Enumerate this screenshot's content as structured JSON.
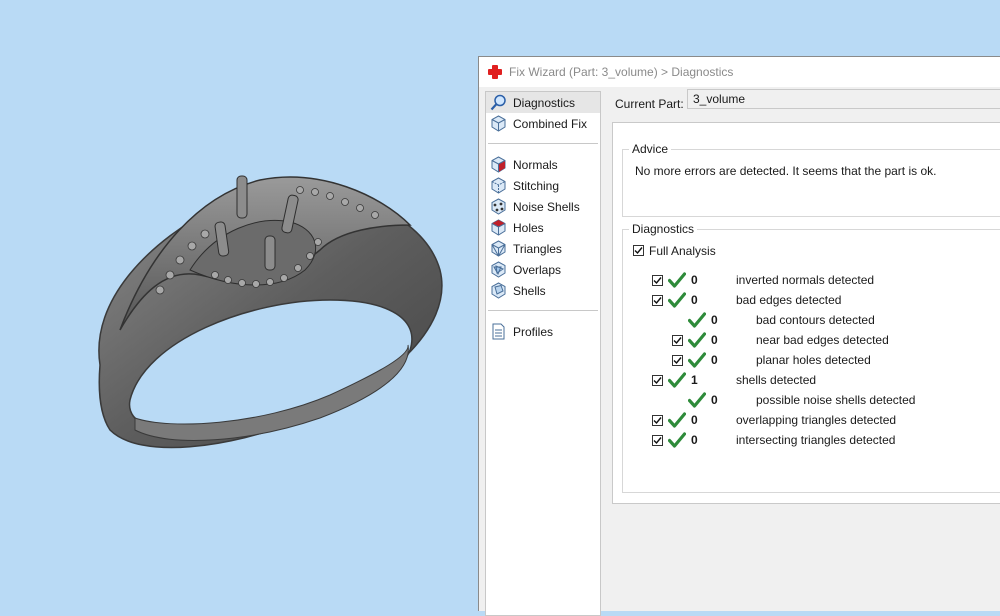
{
  "window": {
    "title": "Fix Wizard (Part: 3_volume) > Diagnostics"
  },
  "nav": {
    "items": [
      {
        "label": "Diagnostics",
        "icon": "magnifier-icon"
      },
      {
        "label": "Combined Fix",
        "icon": "cube-icon"
      },
      {
        "label": "Normals",
        "icon": "normals-cube-icon"
      },
      {
        "label": "Stitching",
        "icon": "stitching-cube-icon"
      },
      {
        "label": "Noise Shells",
        "icon": "noise-shells-icon"
      },
      {
        "label": "Holes",
        "icon": "holes-cube-icon"
      },
      {
        "label": "Triangles",
        "icon": "triangles-cube-icon"
      },
      {
        "label": "Overlaps",
        "icon": "overlaps-cube-icon"
      },
      {
        "label": "Shells",
        "icon": "shells-cube-icon"
      },
      {
        "label": "Profiles",
        "icon": "profiles-document-icon"
      }
    ],
    "selected": "Diagnostics"
  },
  "current_part": {
    "label": "Current Part:",
    "value": "3_volume"
  },
  "advice": {
    "legend": "Advice",
    "text": "No more errors are detected. It seems that the part is ok."
  },
  "diagnostics": {
    "legend": "Diagnostics",
    "full_analysis_label": "Full Analysis",
    "full_analysis_checked": true,
    "rows": [
      {
        "count": "0",
        "label": "inverted normals detected",
        "checked": true,
        "indent": 0
      },
      {
        "count": "0",
        "label": "bad edges detected",
        "checked": true,
        "indent": 0
      },
      {
        "count": "0",
        "label": "bad contours detected",
        "checked": false,
        "indent": 1
      },
      {
        "count": "0",
        "label": "near bad edges detected",
        "checked": true,
        "indent": 1
      },
      {
        "count": "0",
        "label": "planar holes detected",
        "checked": true,
        "indent": 1
      },
      {
        "count": "1",
        "label": "shells detected",
        "checked": true,
        "indent": 0
      },
      {
        "count": "0",
        "label": "possible noise shells detected",
        "checked": false,
        "indent": 1
      },
      {
        "count": "0",
        "label": "overlapping triangles detected",
        "checked": true,
        "indent": 0
      },
      {
        "count": "0",
        "label": "intersecting triangles detected",
        "checked": true,
        "indent": 0
      }
    ]
  },
  "colors": {
    "viewport_background": "#b9daf5",
    "ok_tick": "#2e8b3a",
    "app_icon": "#e02020",
    "model": "#6e6e6e"
  }
}
